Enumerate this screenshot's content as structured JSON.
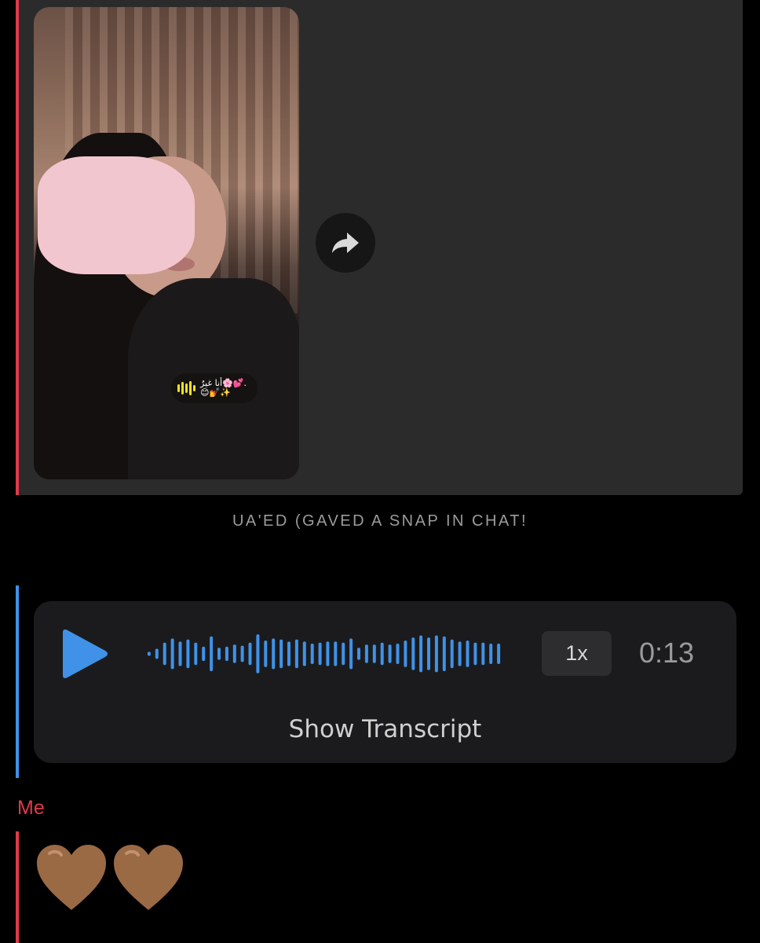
{
  "snap_message": {
    "sticker_text": "أنا غيرٌ🌸💕.",
    "sticker_emoji": "😊💅✨",
    "share_icon": "forward-arrow-icon"
  },
  "status": {
    "text": "UA'ED (GAVED A SNAP IN CHAT!"
  },
  "voice_note": {
    "play_icon": "play-icon",
    "speed_label": "1x",
    "duration": "0:13",
    "transcript_label": "Show Transcript",
    "waveform_levels": [
      0.1,
      0.25,
      0.55,
      0.75,
      0.6,
      0.7,
      0.55,
      0.35,
      0.85,
      0.3,
      0.35,
      0.45,
      0.4,
      0.55,
      0.95,
      0.65,
      0.75,
      0.7,
      0.6,
      0.7,
      0.6,
      0.5,
      0.55,
      0.6,
      0.6,
      0.55,
      0.75,
      0.3,
      0.45,
      0.45,
      0.55,
      0.45,
      0.5,
      0.65,
      0.8,
      0.9,
      0.8,
      0.9,
      0.85,
      0.7,
      0.6,
      0.65,
      0.55,
      0.55,
      0.5,
      0.5
    ]
  },
  "me_message": {
    "sender": "Me",
    "hearts": [
      "🤎",
      "🤎"
    ]
  },
  "colors": {
    "my_accent": "#e0394d",
    "friend_accent": "#3f92e8",
    "heart_brown": "#9a6a45"
  }
}
